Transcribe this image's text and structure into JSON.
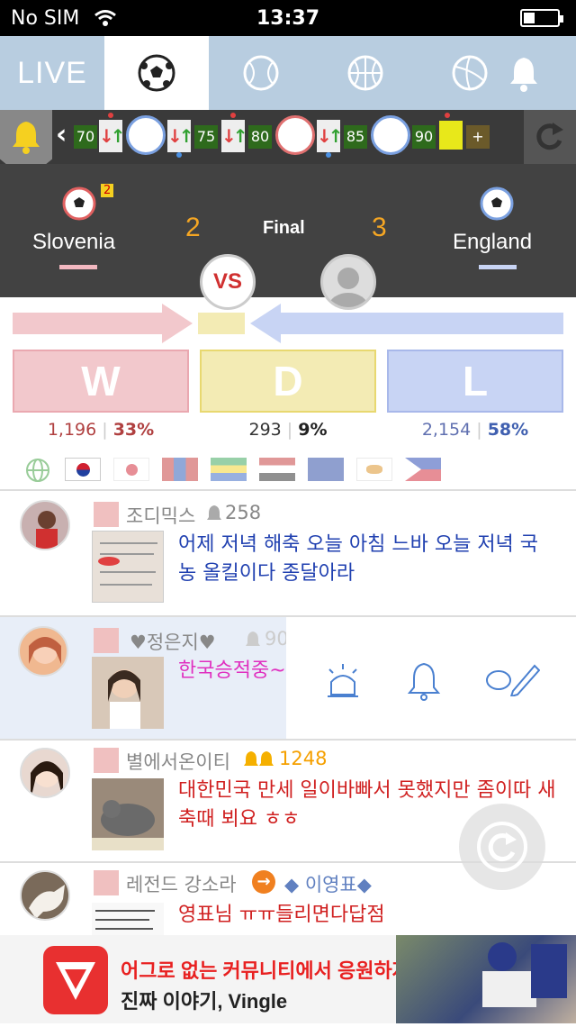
{
  "status_bar": {
    "carrier": "No SIM",
    "time": "13:37"
  },
  "tabs": {
    "live_label": "LIVE",
    "items": [
      "soccer-icon",
      "baseball-icon",
      "basketball-icon",
      "volleyball-icon",
      "bell-icon"
    ]
  },
  "timeline": {
    "minutes": [
      "70",
      "75",
      "80",
      "85",
      "90"
    ],
    "plus": "+"
  },
  "match": {
    "home": {
      "name": "Slovenia",
      "score": "2",
      "badge": "2"
    },
    "away": {
      "name": "England",
      "score": "3"
    },
    "status": "Final",
    "vs": "VS"
  },
  "vote": {
    "w": {
      "label": "W",
      "count": "1,196",
      "pct": "33%",
      "color": "#f2c8cc"
    },
    "d": {
      "label": "D",
      "count": "293",
      "pct": "9%",
      "color": "#f3ebb4"
    },
    "l": {
      "label": "L",
      "count": "2,154",
      "pct": "58%",
      "color": "#c8d4f4"
    }
  },
  "posts": [
    {
      "user": "조디믹스",
      "likes": "258",
      "text": "어제 저녁 해축 오늘 아침 느바 오늘 저녁 국농 올킬이다 종달아라"
    },
    {
      "user": "♥정은지♥",
      "likes": "90",
      "text": "한국승적중~"
    },
    {
      "user": "별에서온이티",
      "likes": "1248",
      "text": "대한민국 만세 일이바빠서 못했지만 좀이따 새축때 뵈요 ㅎㅎ"
    },
    {
      "user": "레전드 강소라",
      "user_extra": "◆ 이영표◆",
      "text": "영표님 ㅠㅠ들리면다답점"
    }
  ],
  "ad": {
    "line1": "어그로 없는 커뮤니티에서 응원하자!!",
    "line2": "진짜 이야기, Vingle"
  }
}
